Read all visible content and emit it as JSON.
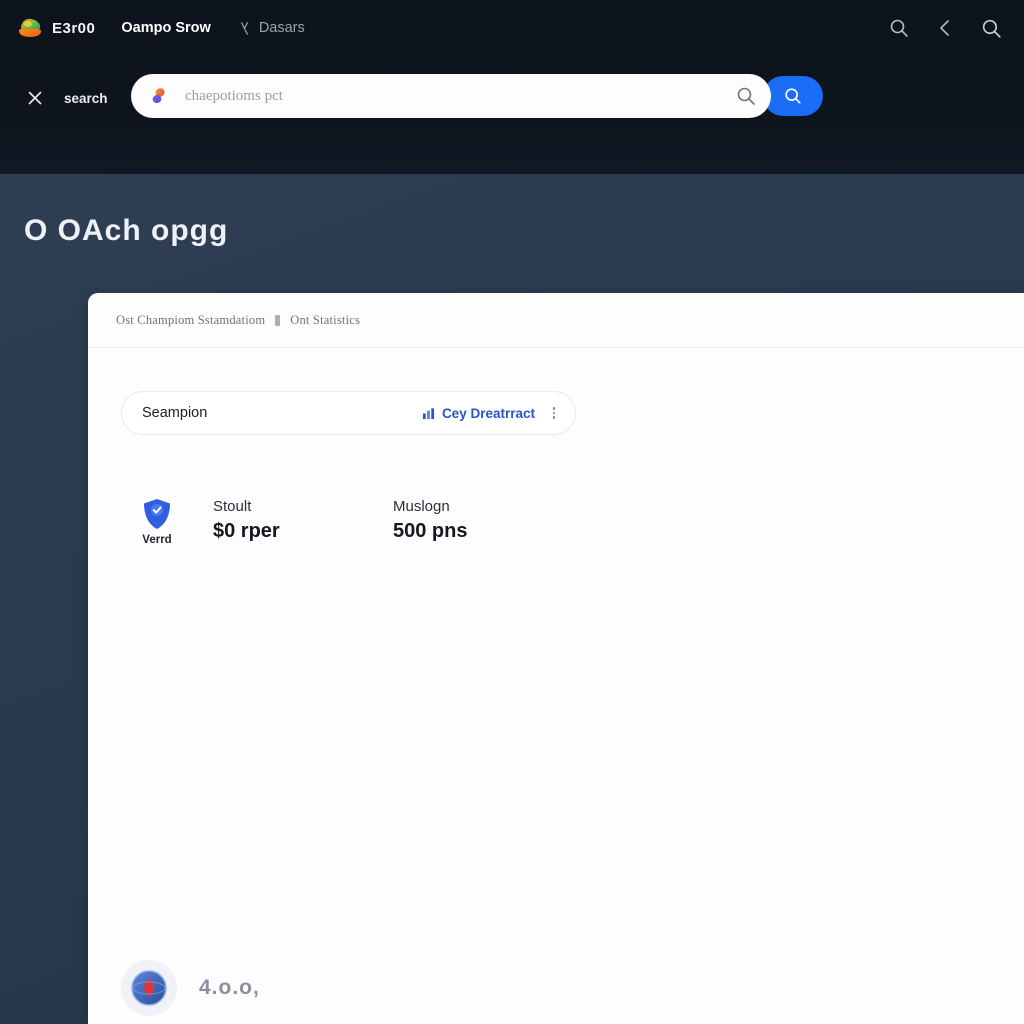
{
  "header": {
    "brand": {
      "name": "E3r00",
      "logo_icon": "colorful-blob-logo"
    },
    "nav_items": [
      {
        "label": "Oampo Srow",
        "icon": ""
      },
      {
        "label": "Dasars",
        "icon": "person-icon"
      }
    ],
    "actions": [
      {
        "name": "search-icon"
      },
      {
        "name": "chevron-left-icon"
      },
      {
        "name": "search-icon"
      }
    ]
  },
  "search": {
    "close_icon": "close-icon",
    "label": "search",
    "field_logo_icon": "colorful-droplet-icon",
    "placeholder": "chaepotioms pct",
    "value": "",
    "inline_icon": "search-icon",
    "submit_icon": "search-icon",
    "accent_color": "#1a6ef5"
  },
  "page": {
    "title": "O OAch  opgg"
  },
  "card": {
    "breadcrumb": [
      "Ost Champiom Sstamdatiom",
      "Ont Statistics"
    ],
    "filter": {
      "label": "Seampion",
      "action_label": "Cey Dreatrract",
      "action_icon": "chart-icon",
      "kebab_icon": "more-vertical-icon",
      "link_color": "#2b52c8"
    },
    "stats": {
      "badge": {
        "icon": "verified-shield-icon",
        "label": "Verrd",
        "color": "#2f5fe0"
      },
      "items": [
        {
          "name": "Stoult",
          "value": "$0 rper"
        },
        {
          "name": "Muslogn",
          "value": "500 pns"
        }
      ]
    },
    "footer": {
      "avatar_icon": "circular-avatar-icon",
      "text": "4.o.o,"
    }
  }
}
